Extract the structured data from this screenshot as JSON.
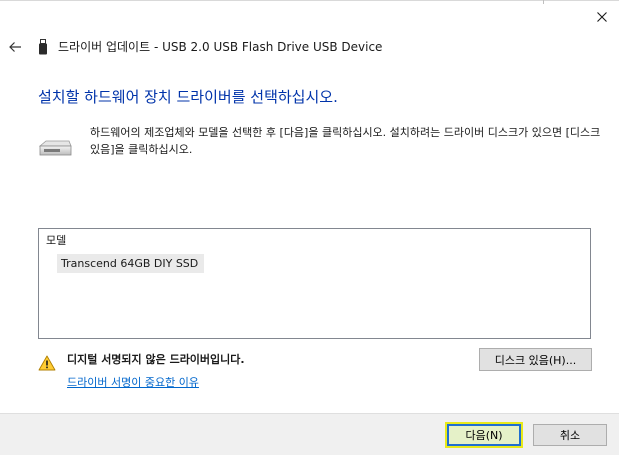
{
  "window": {
    "title": "드라이버 업데이트 - USB 2.0 USB Flash Drive USB Device",
    "close_icon": "close-icon",
    "back_icon": "back-arrow-icon",
    "device_icon": "usb-drive-icon"
  },
  "main": {
    "heading": "설치할 하드웨어 장치 드라이버를 선택하십시오.",
    "instruction": "하드웨어의 제조업체와 모델을 선택한 후 [다음]을 클릭하십시오. 설치하려는 드라이버 디스크가 있으면 [디스크 있음]을 클릭하십시오.",
    "drive_icon": "hard-drive-icon"
  },
  "model_list": {
    "header": "모델",
    "items": [
      "Transcend 64GB DIY SSD"
    ]
  },
  "warning": {
    "icon": "warning-icon",
    "text": "디지털 서명되지 않은 드라이버입니다.",
    "link": "드라이버 서명이 중요한 이유"
  },
  "buttons": {
    "have_disk": "디스크 있음(H)...",
    "next": "다음(N)",
    "cancel": "취소"
  },
  "colors": {
    "heading": "#0033aa",
    "link": "#0066cc",
    "next_highlight": "#e8ea1a",
    "focus_border": "#1f6fd1"
  }
}
